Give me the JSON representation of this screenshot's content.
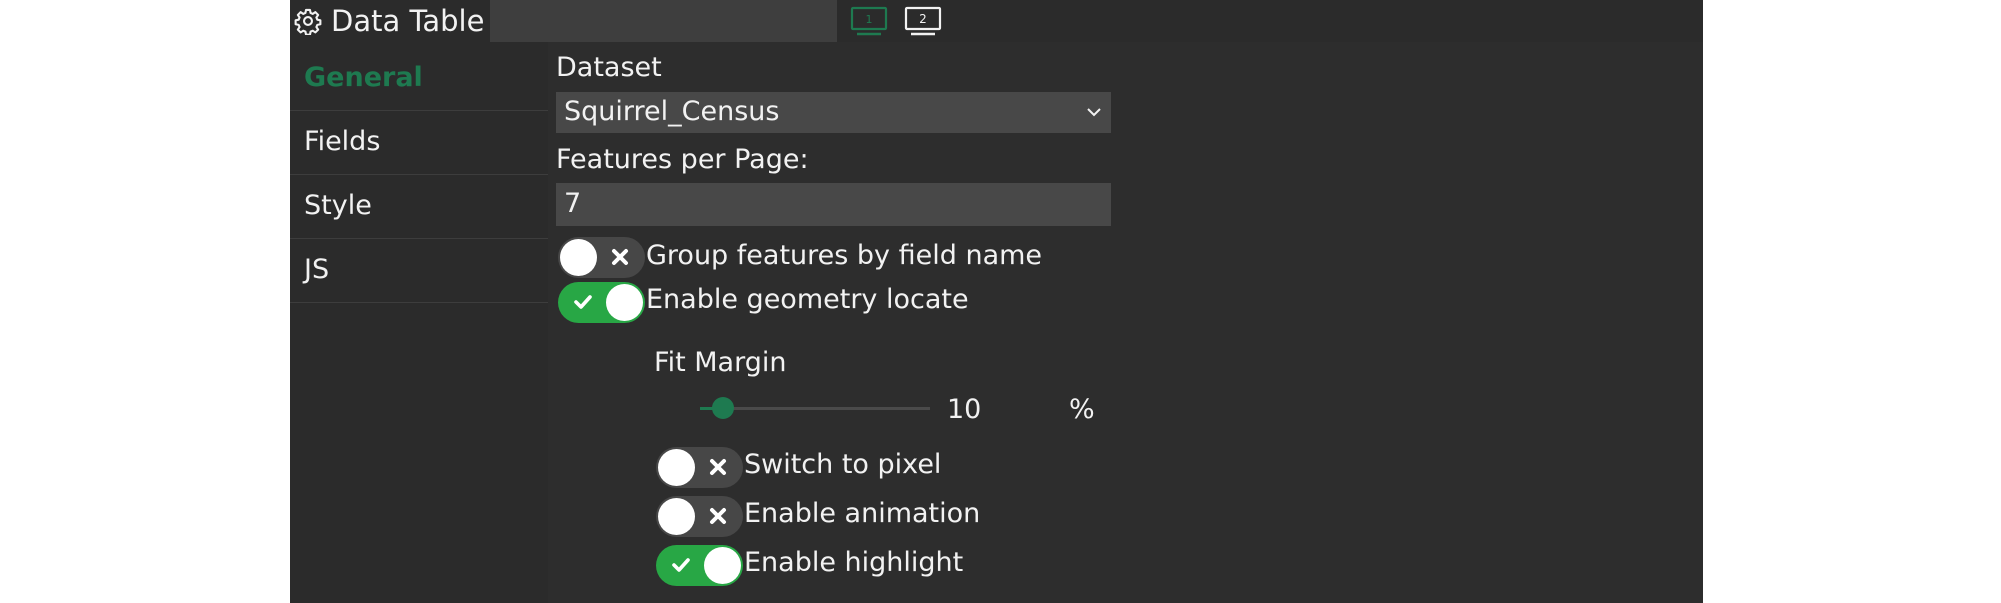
{
  "header": {
    "title": "Data Table",
    "name_input_value": "",
    "monitor1_label": "1",
    "monitor2_label": "2"
  },
  "sidebar": {
    "items": [
      {
        "label": "General",
        "active": true
      },
      {
        "label": "Fields",
        "active": false
      },
      {
        "label": "Style",
        "active": false
      },
      {
        "label": "JS",
        "active": false
      }
    ]
  },
  "general": {
    "dataset_label": "Dataset",
    "dataset_value": "Squirrel_Census",
    "features_per_page_label": "Features per Page:",
    "features_per_page_value": "7",
    "group_by_field": {
      "label": "Group features by field name",
      "on": false
    },
    "geometry_locate": {
      "label": "Enable geometry locate",
      "on": true
    },
    "fit_margin": {
      "label": "Fit Margin",
      "value": "10",
      "unit": "%",
      "slider_fraction": 0.1
    },
    "switch_to_pixel": {
      "label": "Switch to pixel",
      "on": false
    },
    "enable_animation": {
      "label": "Enable animation",
      "on": false
    },
    "enable_highlight": {
      "label": "Enable highlight",
      "on": true
    }
  },
  "colors": {
    "accent_green": "#1e7a50",
    "toggle_on": "#28a745",
    "panel_bg": "#2b2b2b",
    "field_bg": "#484848"
  },
  "icons": {
    "header": "gear-icon",
    "monitors": [
      "monitor-1-icon",
      "monitor-2-icon"
    ],
    "select": "chevron-down-icon",
    "toggle_on": "check-icon",
    "toggle_off": "close-icon"
  }
}
